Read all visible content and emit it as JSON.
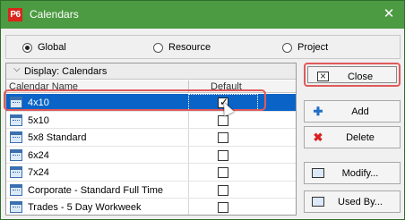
{
  "window": {
    "logo_text": "P6",
    "title": "Calendars",
    "close_glyph": "✕"
  },
  "scope": {
    "options": [
      {
        "label": "Global",
        "selected": true
      },
      {
        "label": "Resource",
        "selected": false
      },
      {
        "label": "Project",
        "selected": false
      }
    ]
  },
  "grid": {
    "display_label": "Display: Calendars",
    "columns": {
      "name": "Calendar Name",
      "default": "Default"
    },
    "rows": [
      {
        "name": "4x10",
        "default": true,
        "selected": true
      },
      {
        "name": "5x10",
        "default": false,
        "selected": false
      },
      {
        "name": "5x8 Standard",
        "default": false,
        "selected": false
      },
      {
        "name": "6x24",
        "default": false,
        "selected": false
      },
      {
        "name": "7x24",
        "default": false,
        "selected": false
      },
      {
        "name": "Corporate - Standard Full Time",
        "default": false,
        "selected": false
      },
      {
        "name": "Trades - 5 Day Workweek",
        "default": false,
        "selected": false
      }
    ]
  },
  "buttons": {
    "close": "Close",
    "add": "Add",
    "delete": "Delete",
    "modify": "Modify...",
    "used_by": "Used By..."
  },
  "colors": {
    "titlebar": "#4c9a42",
    "selection": "#0a64c8",
    "highlight": "#e05a5a"
  }
}
